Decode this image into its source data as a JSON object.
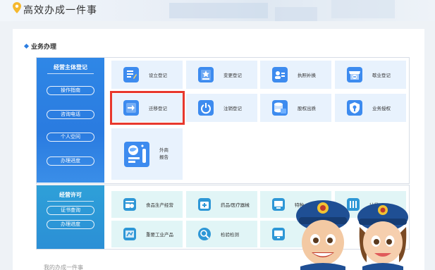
{
  "header": {
    "slogan": "高效办成一件事"
  },
  "section": {
    "title": "业务办理"
  },
  "registration": {
    "title": "经营主体登记",
    "side_buttons": [
      "操作指南",
      "咨询电话",
      "个人空间",
      "办理进度"
    ],
    "tiles": [
      {
        "label": "设立登记",
        "icon": "pen-document-icon"
      },
      {
        "label": "变更登记",
        "icon": "star-document-icon"
      },
      {
        "label": "执照补换",
        "icon": "license-card-icon"
      },
      {
        "label": "歇业登记",
        "icon": "shop-closed-icon"
      },
      {
        "label": "迁移登记",
        "icon": "arrow-move-icon"
      },
      {
        "label": "注销登记",
        "icon": "power-off-icon"
      },
      {
        "label": "股权出质",
        "icon": "equity-pledge-icon"
      },
      {
        "label": "业务授权",
        "icon": "authorize-shield-icon"
      }
    ],
    "foreign": {
      "label_line1": "外商",
      "label_line2": "报告",
      "icon": "globe-report-icon"
    }
  },
  "license": {
    "title": "经营许可",
    "side_buttons": [
      "证书查询",
      "办理进度"
    ],
    "tiles": [
      {
        "label": "食品生产经营",
        "icon": "food-production-icon"
      },
      {
        "label": "药品/医疗器械",
        "icon": "medical-kit-icon"
      },
      {
        "label": "特种",
        "icon": "special-equipment-icon"
      },
      {
        "label": "计量",
        "icon": "metering-icon"
      },
      {
        "label": "重要工业产品",
        "icon": "industrial-product-icon"
      },
      {
        "label": "检验检测",
        "icon": "inspection-icon"
      },
      {
        "label": "",
        "icon": "monitor-icon"
      }
    ]
  },
  "footer": {
    "fade_text": "我的办成一件事"
  },
  "colors": {
    "accent": "#2b7de1",
    "highlight": "#e8382d",
    "tile_bg": "#e8f2fd",
    "tile_teal_bg": "#e1f5f6"
  }
}
